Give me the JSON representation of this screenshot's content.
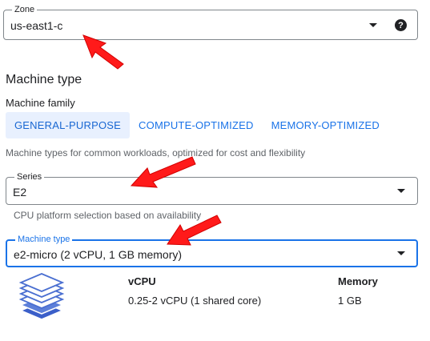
{
  "zone": {
    "label": "Zone",
    "value": "us-east1-c",
    "help_glyph": "?"
  },
  "machine_configuration": {
    "title": "Machine type",
    "family_label": "Machine family",
    "family_tabs": [
      {
        "label": "GENERAL-PURPOSE",
        "selected": true
      },
      {
        "label": "COMPUTE-OPTIMIZED",
        "selected": false
      },
      {
        "label": "MEMORY-OPTIMIZED",
        "selected": false
      }
    ],
    "family_hint": "Machine types for common workloads, optimized for cost and flexibility"
  },
  "series": {
    "label": "Series",
    "value": "E2",
    "hint": "CPU platform selection based on availability"
  },
  "machine_type": {
    "label": "Machine type",
    "value": "e2-micro (2 vCPU, 1 GB memory)"
  },
  "specs": {
    "vcpu_header": "vCPU",
    "vcpu_value": "0.25-2 vCPU (1 shared core)",
    "memory_header": "Memory",
    "memory_value": "1 GB"
  },
  "colors": {
    "accent": "#1a73e8",
    "selected_tab_bg": "#e8f0fe",
    "arrow": "#ff1a1a",
    "stack_icon": "#4a6fd1"
  },
  "annotations": [
    "red-arrow-zone",
    "red-arrow-series",
    "red-arrow-machine-type"
  ]
}
